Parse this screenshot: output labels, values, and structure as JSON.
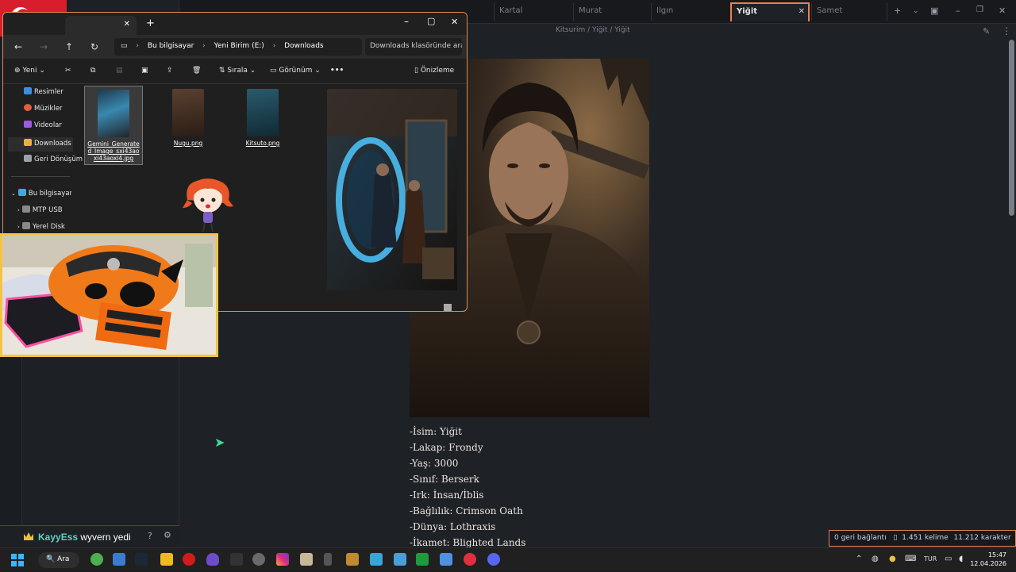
{
  "obsidian": {
    "tabs": [
      "Kartal",
      "Murat",
      "Ilgın",
      "Yiğit",
      "Samet"
    ],
    "active_tab": "Yiğit",
    "breadcrumb": "Kitsurim / Yiğit / Yiğit",
    "character_info": [
      "-İsim: Yiğit",
      "-Lakap: Frondy",
      "-Yaş: 3000",
      "-Sınıf: Berserk",
      "-Irk: İnsan/İblis",
      "-Bağlılık: Crimson Oath",
      "-Dünya: Lothraxis",
      "-İkamet: Blighted Lands"
    ],
    "status": {
      "backlinks": "0 geri bağlantı",
      "words": "1.451 kelime",
      "chars": "11.212 karakter"
    }
  },
  "explorer": {
    "address": [
      "Bu bilgisayar",
      "Yeni Birim (E:)",
      "Downloads"
    ],
    "search_placeholder": "Downloads klasöründe ara",
    "toolbar": {
      "new": "Yeni",
      "sort": "Sırala",
      "view": "Görünüm",
      "preview": "Önizleme"
    },
    "nav": [
      {
        "label": "Resimler",
        "color": "#3f8fe0"
      },
      {
        "label": "Müzikler",
        "color": "#e0603f"
      },
      {
        "label": "Videolar",
        "color": "#a05ae0"
      },
      {
        "label": "Downloads",
        "color": "#e8b23a"
      },
      {
        "label": "Geri Dönüşüm",
        "color": "#9aa0a8"
      },
      {
        "label": "Bu bilgisayar",
        "color": "#3fa9e0"
      },
      {
        "label": "MTP USB",
        "color": "#888888"
      },
      {
        "label": "Yerel Disk",
        "color": "#888888"
      }
    ],
    "files": [
      "Gemini_Generated_Image_sxi43aoxi43aoxi4.jpg",
      "Nugu.png",
      "Kitsuto.png"
    ]
  },
  "chat": {
    "user": "KayyEss",
    "message": "wyvern yedi"
  },
  "taskbar": {
    "search": "Ara",
    "lang": "TUR",
    "time": "15:47",
    "date": "12.04.2026"
  }
}
